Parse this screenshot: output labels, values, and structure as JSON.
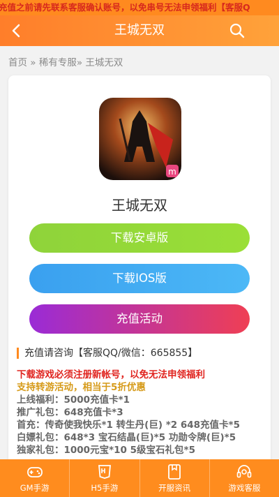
{
  "marquee": {
    "text": "充值之前请先联系客服确认账号，以免串号无法申领福利【客服Q"
  },
  "header": {
    "title": "王城无双"
  },
  "breadcrumb": {
    "home": "首页",
    "sep1": " » ",
    "section": "稀有专服",
    "sep2": "» ",
    "current": "王城无双"
  },
  "game": {
    "name": "王城无双",
    "download_android": "下载安卓版",
    "download_ios": "下载IOS版",
    "recharge": "充值活动"
  },
  "consult": {
    "text": "充值请咨询【客服QQ/微信：665855】"
  },
  "info": {
    "line1": "下载游戏必须注册新帐号，以免无法申领福利",
    "line2": "支持转游活动，相当于5折优惠",
    "line3": "上线福利：5000充值卡*1",
    "line4": "推广礼包：648充值卡*3",
    "line5": "首充：传奇使我快乐*1 转生丹(巨) *2 648充值卡*5",
    "line6": "白嫖礼包：648*3 宝石结晶(巨)*5 功勋令牌(巨)*5",
    "line7": "独家礼包：1000元宝*10 5级宝石礼包*5"
  },
  "tabbar": {
    "items": [
      {
        "label": "GM手游",
        "icon": "gamepad-icon"
      },
      {
        "label": "H5手游",
        "icon": "h5-icon"
      },
      {
        "label": "开服资讯",
        "icon": "news-icon"
      },
      {
        "label": "游戏客服",
        "icon": "headset-icon"
      }
    ]
  },
  "colors": {
    "accent": "#ff8a1f",
    "android": "#94d838",
    "ios": "#41aaf2",
    "recharge_start": "#9a2bd6",
    "recharge_end": "#ef3f54"
  }
}
